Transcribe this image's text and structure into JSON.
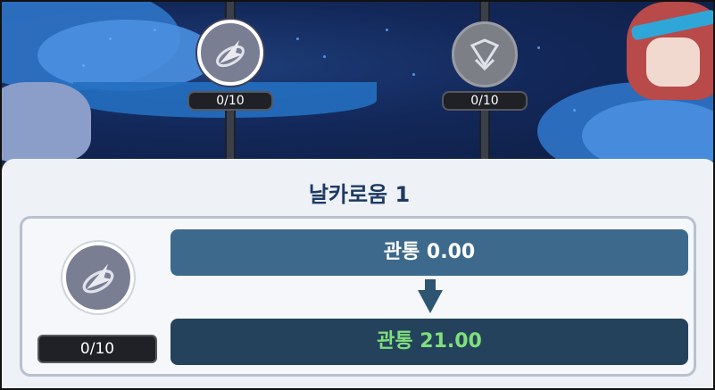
{
  "scene": {
    "nodes": [
      {
        "icon": "dash-arrow-icon",
        "count": "0/10",
        "selected": true
      },
      {
        "icon": "gem-heart-icon",
        "count": "0/10",
        "selected": false
      }
    ]
  },
  "panel": {
    "title": "날카로움 1",
    "skill": {
      "icon": "dash-arrow-icon",
      "count": "0/10"
    },
    "stat_before": "관통 0.00",
    "stat_after": "관통 21.00"
  },
  "colors": {
    "panel_bg": "#eef1f6",
    "title": "#1d3a63",
    "bar_before": "#3d6a8c",
    "bar_after": "#25425d",
    "after_text": "#7fe07a"
  }
}
